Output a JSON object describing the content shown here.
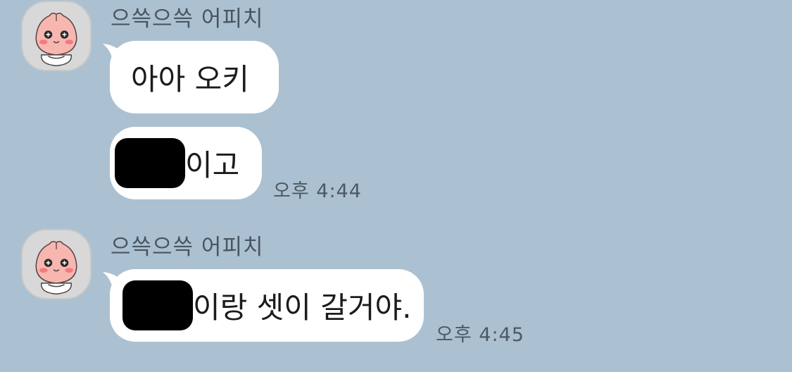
{
  "messages": [
    {
      "sender": "으쓱으쓱 어피치",
      "avatar_icon": "apeach-avatar-icon",
      "bubbles": [
        {
          "text": "아아 오키",
          "redacted_prefix": false
        },
        {
          "text": "이고",
          "redacted_prefix": true
        }
      ],
      "time": "오후 4:44"
    },
    {
      "sender": "으쓱으쓱 어피치",
      "avatar_icon": "apeach-avatar-icon",
      "bubbles": [
        {
          "text": "이랑 셋이 갈거야.",
          "redacted_prefix": true
        }
      ],
      "time": "오후 4:45"
    }
  ],
  "colors": {
    "background": "#abc1d1",
    "bubble": "#ffffff",
    "redaction": "#000000",
    "avatar_face": "#f7b7b0"
  }
}
